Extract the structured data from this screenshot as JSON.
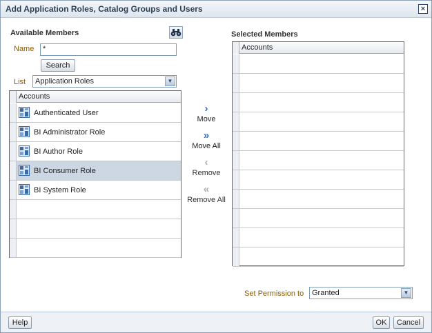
{
  "dialog": {
    "title": "Add Application Roles, Catalog Groups and Users",
    "close_glyph": "×"
  },
  "available": {
    "heading": "Available Members",
    "name_label": "Name",
    "name_value": "*",
    "search_label": "Search",
    "list_label": "List",
    "list_selected": "Application Roles",
    "column_header": "Accounts",
    "items": [
      {
        "label": "Authenticated User",
        "icon": "app-role-icon",
        "selected": false
      },
      {
        "label": "BI Administrator Role",
        "icon": "app-role-icon",
        "selected": false
      },
      {
        "label": "BI Author Role",
        "icon": "app-role-icon",
        "selected": false
      },
      {
        "label": "BI Consumer Role",
        "icon": "app-role-icon",
        "selected": true
      },
      {
        "label": "BI System Role",
        "icon": "app-role-icon",
        "selected": false
      }
    ]
  },
  "shuttle": {
    "move": "Move",
    "move_all": "Move All",
    "remove": "Remove",
    "remove_all": "Remove All",
    "move_glyph": "›",
    "move_all_glyph": "»",
    "remove_glyph": "‹",
    "remove_all_glyph": "«"
  },
  "selected": {
    "heading": "Selected Members",
    "column_header": "Accounts"
  },
  "permission": {
    "label": "Set Permission to",
    "value": "Granted"
  },
  "footer": {
    "help": "Help",
    "ok": "OK",
    "cancel": "Cancel"
  },
  "colors": {
    "selected_row": "#cdd6e3",
    "shuttle_enabled": "#2d6fc4",
    "label_accent": "#8a5a00"
  }
}
